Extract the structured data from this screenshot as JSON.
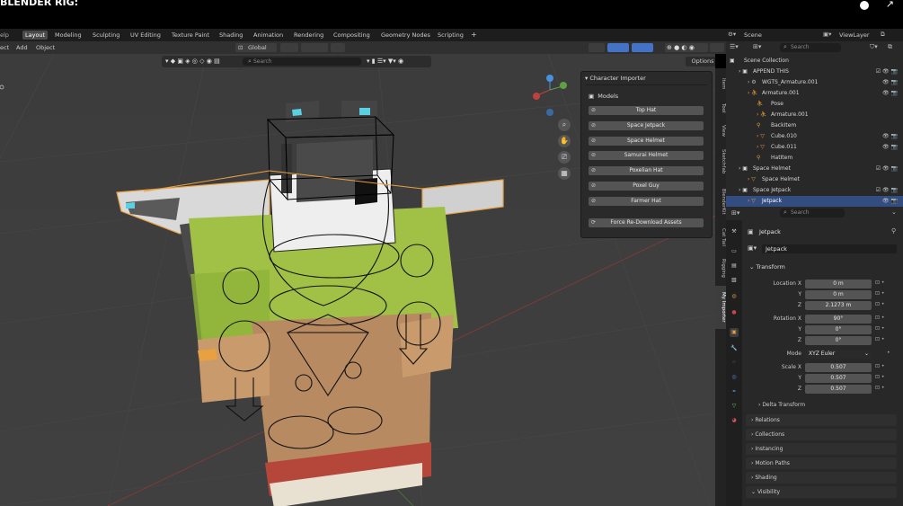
{
  "topbar": {
    "title": "BLENDER RIG:"
  },
  "workspace_tabs": [
    "Layout",
    "Modeling",
    "Sculpting",
    "UV Editing",
    "Texture Paint",
    "Shading",
    "Animation",
    "Rendering",
    "Compositing",
    "Geometry Nodes",
    "Scripting",
    "+"
  ],
  "header_menu": [
    "ect",
    "Add",
    "Object"
  ],
  "transform_orientation": "Global",
  "viewport": {
    "search_placeholder": "Search",
    "options_label": "Options"
  },
  "panel": {
    "title": "Character Importer",
    "subtitle": "Models",
    "buttons": [
      "Top Hat",
      "Space Jetpack",
      "Space Helmet",
      "Samurai Helmet",
      "Poxelian Hat",
      "Poxel Guy",
      "Farmer Hat"
    ],
    "force_label": "Force Re-Download Assets"
  },
  "sidebar_tabs": [
    "Item",
    "Tool",
    "View",
    "Sketchfab",
    "BlenderKit",
    "Cat Tail",
    "Rigging",
    "My Importer"
  ],
  "right_header": {
    "scene": "Scene",
    "view_layer": "ViewLayer"
  },
  "outliner": {
    "search_placeholder": "Search",
    "rows": [
      {
        "label": "Scene Collection",
        "indent": 0
      },
      {
        "label": "APPEND THIS",
        "indent": 1
      },
      {
        "label": "WGTS_Armature.001",
        "indent": 2
      },
      {
        "label": "Armature.001",
        "indent": 2
      },
      {
        "label": "Pose",
        "indent": 3
      },
      {
        "label": "Armature.001",
        "indent": 3
      },
      {
        "label": "BackItem",
        "indent": 3
      },
      {
        "label": "Cube.010",
        "indent": 3
      },
      {
        "label": "Cube.011",
        "indent": 3
      },
      {
        "label": "HatItem",
        "indent": 3
      },
      {
        "label": "Space Helmet",
        "indent": 1
      },
      {
        "label": "Space Helmet",
        "indent": 2
      },
      {
        "label": "Space Jetpack",
        "indent": 1
      },
      {
        "label": "Jetpack",
        "indent": 2
      }
    ]
  },
  "properties": {
    "search_placeholder": "Search",
    "object_name": "Jetpack",
    "data_name": "Jetpack",
    "transform_label": "Transform",
    "location_label": "Location X",
    "location": [
      "0 m",
      "0 m",
      "2.1273 m"
    ],
    "rotation_label": "Rotation X",
    "rotation": [
      "90°",
      "0°",
      "0°"
    ],
    "mode_label": "Mode",
    "mode_value": "XYZ Euler",
    "scale_label": "Scale X",
    "scale": [
      "0.507",
      "0.507",
      "0.507"
    ],
    "axis_y": "Y",
    "axis_z": "Z",
    "sections": [
      "Delta Transform",
      "Relations",
      "Collections",
      "Instancing",
      "Motion Paths",
      "Shading",
      "Visibility"
    ]
  },
  "colors": {
    "accent_blue": "#334d80",
    "jetpack_orange": "#e8a040",
    "shirt_green": "#9bbf3a",
    "skin": "#b88a62"
  }
}
